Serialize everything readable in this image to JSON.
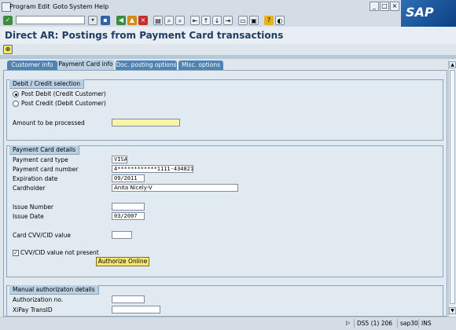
{
  "menubar": {
    "items": [
      "Program",
      "Edit",
      "Goto",
      "System",
      "Help"
    ]
  },
  "toolbar": {
    "command_value": "",
    "icons": [
      "enter-icon",
      "save-icon",
      "back-icon",
      "exit-icon",
      "cancel-icon",
      "print-icon",
      "find-icon",
      "find-next-icon",
      "first-page-icon",
      "prev-page-icon",
      "next-page-icon",
      "last-page-icon",
      "new-session-icon",
      "shortcut-icon",
      "help-icon",
      "customize-icon"
    ]
  },
  "logo": "SAP",
  "title": "Direct AR: Postings from Payment Card transactions",
  "tabs": [
    "Customer info",
    "Payment Card info",
    "Doc. posting options",
    "Misc. options"
  ],
  "active_tab": 1,
  "debit_credit": {
    "title": "Debit / Credit selection",
    "options": [
      "Post Debit (Credit Customer)",
      "Post Credit (Debit Customer)"
    ],
    "selected": 0,
    "amount_label": "Amount to be processed",
    "amount_value": ""
  },
  "card_details": {
    "title": "Payment Card details",
    "type_label": "Payment card type",
    "type_value": "VISA",
    "number_label": "Payment card number",
    "number_value": "4************1111-43482147",
    "expiry_label": "Expiration date",
    "expiry_value": "09/2011",
    "holder_label": "Cardholder",
    "holder_value": "Anita Nicely-V",
    "issue_number_label": "Issue Number",
    "issue_number_value": "",
    "issue_date_label": "Issue Date",
    "issue_date_value": "03/2007",
    "cvv_label": "Card CVV/CID value",
    "cvv_value": "",
    "cvv_not_present_label": "CVV/CID value not present",
    "cvv_not_present_checked": true,
    "authorize_label": "Authorize Online"
  },
  "manual_auth": {
    "title": "Manual authorizaton details",
    "auth_no_label": "Authorization no.",
    "auth_no_value": "",
    "xipay_label": "XiPay TransID",
    "xipay_value": ""
  },
  "status": {
    "session": "DS5 (1) 206",
    "server": "sap30",
    "mode": "INS"
  },
  "colors": {
    "tab_inactive": "#4f83b2",
    "tab_active": "#b9cfe2",
    "required_field": "#f8f3a6",
    "button": "#f5e96f"
  }
}
